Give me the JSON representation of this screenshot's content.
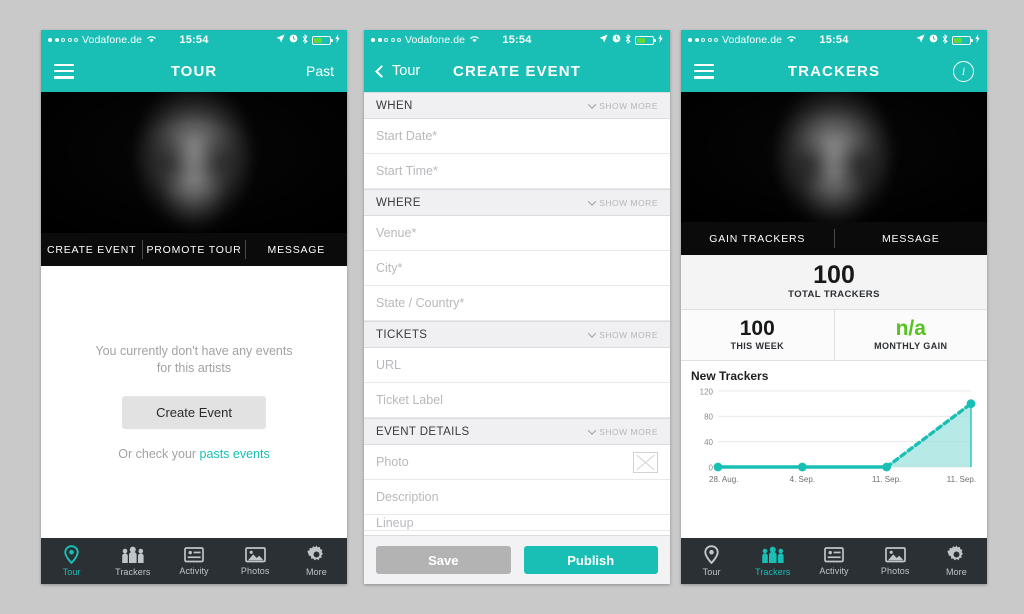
{
  "statusbar": {
    "carrier": "Vodafone.de",
    "time": "15:54",
    "signal_dots_filled": 2,
    "signal_dots_total": 5,
    "icons": [
      "location-arrow-icon",
      "alarm-icon",
      "bluetooth-icon",
      "battery-icon",
      "charging-bolt-icon"
    ]
  },
  "theme": {
    "accent": "#19bfb5",
    "green": "#56c221",
    "tabbar_bg": "#2b3035",
    "hero_bg": "#050505"
  },
  "phone1": {
    "nav": {
      "menu": "menu-icon",
      "title": "TOUR",
      "right_label": "Past"
    },
    "actions": [
      "CREATE EVENT",
      "PROMOTE TOUR",
      "MESSAGE"
    ],
    "empty": {
      "line1": "You currently don't have any events",
      "line2": "for this artists",
      "button": "Create Event",
      "check_prefix": "Or check your ",
      "check_link": "pasts events"
    },
    "tabs": [
      {
        "label": "Tour",
        "icon": "map-pin-icon",
        "active": true
      },
      {
        "label": "Trackers",
        "icon": "people-group-icon",
        "active": false
      },
      {
        "label": "Activity",
        "icon": "activity-card-icon",
        "active": false
      },
      {
        "label": "Photos",
        "icon": "photo-icon",
        "active": false
      },
      {
        "label": "More",
        "icon": "gear-icon",
        "active": false
      }
    ]
  },
  "phone2": {
    "nav": {
      "back_label": "Tour",
      "title": "CREATE EVENT"
    },
    "show_more_label": "SHOW MORE",
    "sections": [
      {
        "title": "WHEN",
        "fields": [
          "Start Date*",
          "Start Time*"
        ]
      },
      {
        "title": "WHERE",
        "fields": [
          "Venue*",
          "City*",
          "State / Country*"
        ]
      },
      {
        "title": "TICKETS",
        "fields": [
          "URL",
          "Ticket Label"
        ]
      },
      {
        "title": "EVENT DETAILS",
        "fields": [
          "Photo",
          "Description",
          "Lineup"
        ]
      }
    ],
    "buttons": {
      "save": "Save",
      "publish": "Publish"
    }
  },
  "phone3": {
    "nav": {
      "menu": "menu-icon",
      "title": "TRACKERS",
      "info": "i"
    },
    "actions": [
      "GAIN TRACKERS",
      "MESSAGE"
    ],
    "stats": {
      "total": {
        "value": "100",
        "caption": "TOTAL TRACKERS"
      },
      "week": {
        "value": "100",
        "caption": "THIS WEEK"
      },
      "monthly": {
        "value": "n/a",
        "caption": "MONTHLY GAIN"
      }
    },
    "tabs": [
      {
        "label": "Tour",
        "icon": "map-pin-icon",
        "active": false
      },
      {
        "label": "Trackers",
        "icon": "people-group-icon",
        "active": true
      },
      {
        "label": "Activity",
        "icon": "activity-card-icon",
        "active": false
      },
      {
        "label": "Photos",
        "icon": "photo-icon",
        "active": false
      },
      {
        "label": "More",
        "icon": "gear-icon",
        "active": false
      }
    ]
  },
  "chart_data": {
    "type": "line",
    "title": "New Trackers",
    "xlabel": "",
    "ylabel": "",
    "x": [
      "28. Aug.",
      "4. Sep.",
      "11. Sep.",
      "11. Sep."
    ],
    "values": [
      0,
      0,
      0,
      100
    ],
    "yticks": [
      0,
      40,
      80,
      120
    ],
    "ylim": [
      0,
      120
    ],
    "grid": true,
    "legend": "none",
    "series": [
      {
        "name": "New Trackers",
        "values": [
          0,
          0,
          0,
          100
        ],
        "style": "solid-then-dashed",
        "color": "#19bfb5",
        "fill": "#9fe3de"
      }
    ],
    "annotations": [
      "last segment is dashed (projection) with shaded area fill"
    ]
  }
}
